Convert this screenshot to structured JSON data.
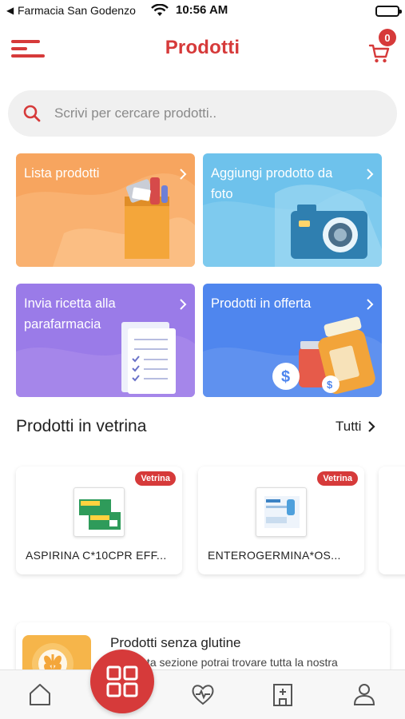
{
  "status_bar": {
    "back_glyph": "◀",
    "carrier": "Farmacia San Godenzo",
    "time": "10:56 AM",
    "wifi_icon": "wifi-icon",
    "battery_icon": "battery-icon"
  },
  "header": {
    "title": "Prodotti",
    "menu_icon": "hamburger-menu-icon",
    "cart_icon": "cart-icon",
    "cart_count": "0"
  },
  "search": {
    "placeholder": "Scrivi per cercare prodotti..",
    "value": ""
  },
  "tiles": [
    {
      "label": "Lista prodotti",
      "color": "#f7a55f"
    },
    {
      "label": "Aggiungi prodotto da foto",
      "color": "#6ec2ec"
    },
    {
      "label": "Invia ricetta alla parafarmacia",
      "color": "#9a7be8"
    },
    {
      "label": "Prodotti in offerta",
      "color": "#4f86ee"
    }
  ],
  "showcase": {
    "title": "Prodotti in vetrina",
    "see_all": "Tutti",
    "items": [
      {
        "name": "ASPIRINA C*10CPR EFF...",
        "badge": "Vetrina"
      },
      {
        "name": "ENTEROGERMINA*OS...",
        "badge": "Vetrina"
      }
    ]
  },
  "gluten_card": {
    "title": "Prodotti senza glutine",
    "description": "In questa sezione potrai trovare tutta la nostra"
  },
  "bottom_nav": {
    "items": [
      "home-icon",
      "grid-icon",
      "heart-pulse-icon",
      "pharmacy-icon",
      "user-icon"
    ],
    "accent": "#d63a3a"
  },
  "colors": {
    "brand": "#d63a3a",
    "search_bg": "#f0f0f0"
  }
}
